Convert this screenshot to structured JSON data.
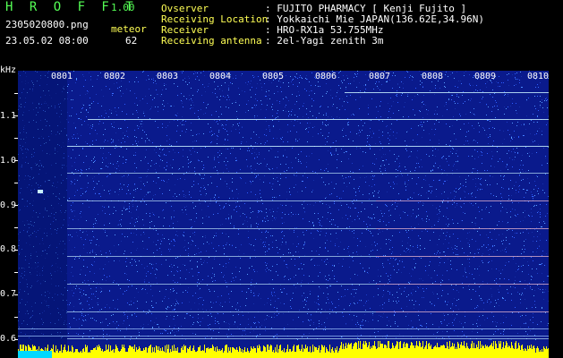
{
  "app": {
    "logo": "H R O F F T",
    "version": "1.00"
  },
  "file": {
    "name": "2305020800.png",
    "timestamp": "23.05.02 08:00",
    "meteor_label": "meteor",
    "meteor_count": "62"
  },
  "info": {
    "labels": [
      "Ovserver",
      "Receiving Location",
      "Receiver",
      "Receiving antenna"
    ],
    "values": [
      ": FUJITO PHARMACY [ Kenji Fujito ]",
      ": Yokkaichi Mie JAPAN(136.62E,34.96N)",
      ": HRO-RX1a 53.755MHz",
      ": 2el-Yagi zenith 3m"
    ]
  },
  "axes": {
    "unit": "kHz",
    "y_ticks": [
      "1.1",
      "1.0",
      "0.9",
      "0.8",
      "0.7",
      "0.6"
    ],
    "x_ticks": [
      "0801",
      "0802",
      "0803",
      "0804",
      "0805",
      "0806",
      "0807",
      "0808",
      "0809",
      "0810"
    ]
  },
  "colors": {
    "background": "#000000",
    "spectrum_base": "#0a1a8c",
    "noise": "#2d5cff",
    "echo_line": "#c8f0ff",
    "signal_bar": "#ffff00",
    "label_green": "#55ff55",
    "label_yellow": "#ffff55"
  }
}
